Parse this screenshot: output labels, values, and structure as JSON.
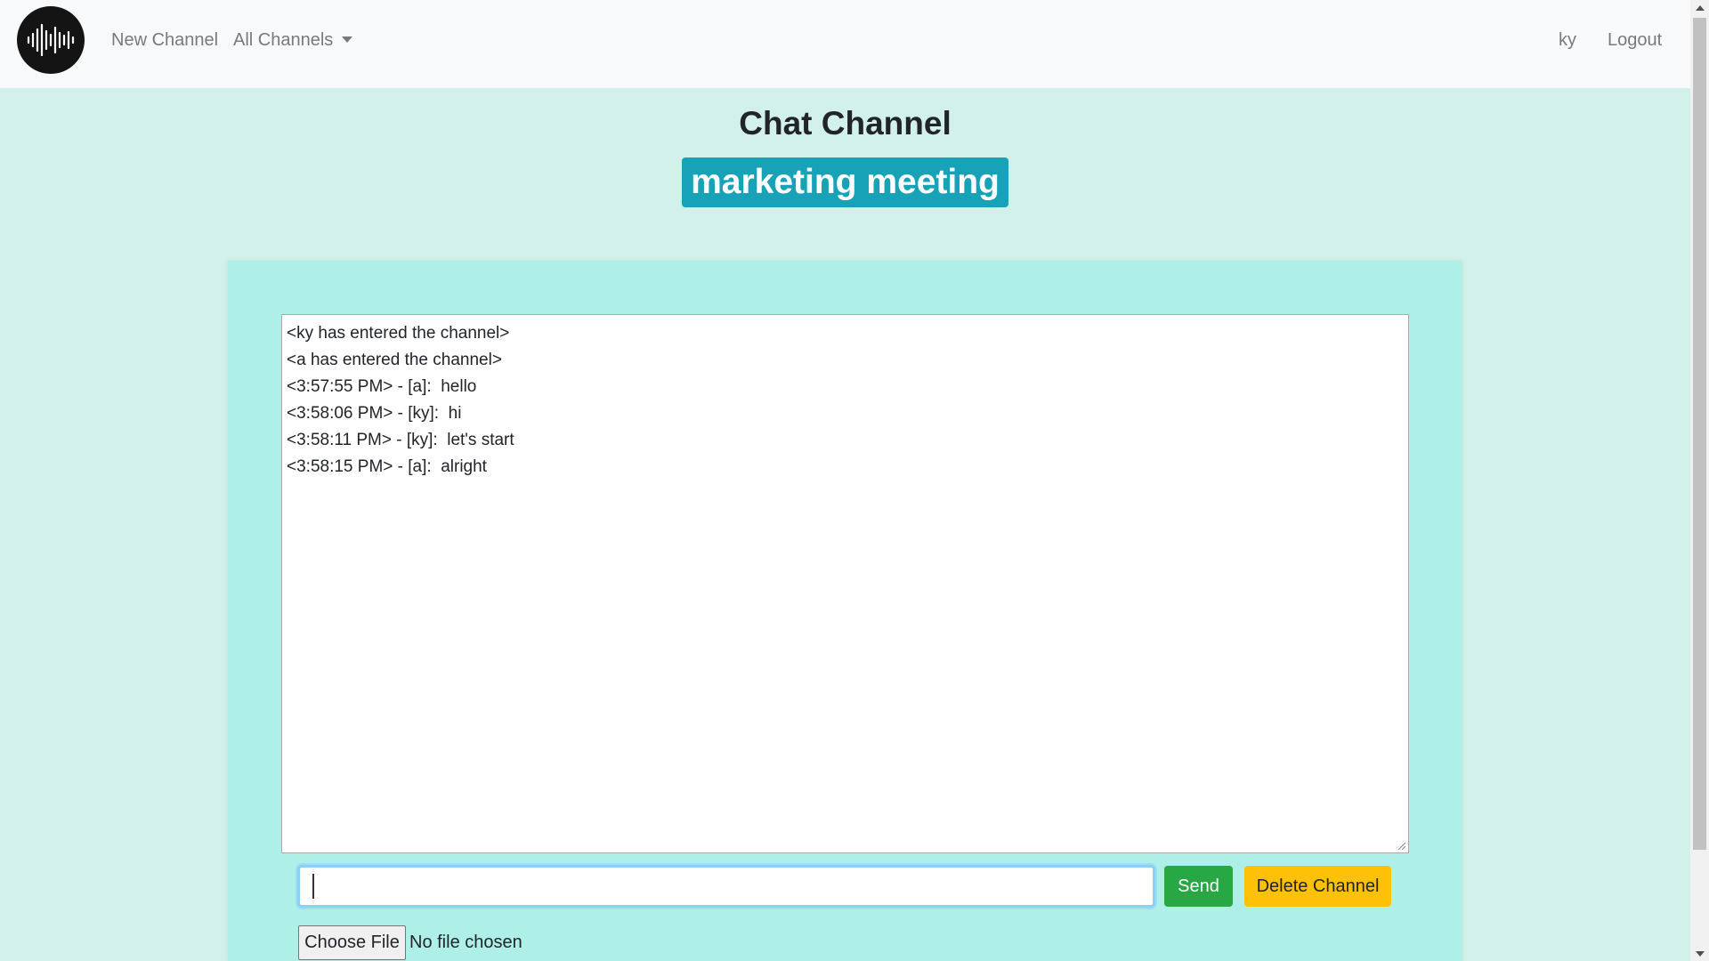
{
  "navbar": {
    "logo_icon": "sound-wave-icon",
    "new_channel_label": "New Channel",
    "all_channels_label": "All Channels",
    "username": "ky",
    "logout_label": "Logout"
  },
  "header": {
    "title": "Chat Channel",
    "channel_name": "marketing meeting"
  },
  "chat": {
    "messages": [
      "<ky has entered the channel>",
      "<a has entered the channel>",
      "<3:57:55 PM> - [a]:  hello",
      "<3:58:06 PM> - [ky]:  hi",
      "<3:58:11 PM> - [ky]:  let's start",
      "<3:58:15 PM> - [a]:  alright"
    ],
    "input_value": "",
    "send_label": "Send",
    "delete_label": "Delete Channel",
    "choose_file_label": "Choose File",
    "file_status": "No file chosen"
  },
  "colors": {
    "page_bg": "#d3f1eb",
    "panel_bg": "#aef0e7",
    "badge_bg": "#17a2b8",
    "send_bg": "#28a745",
    "delete_bg": "#ffc107"
  }
}
